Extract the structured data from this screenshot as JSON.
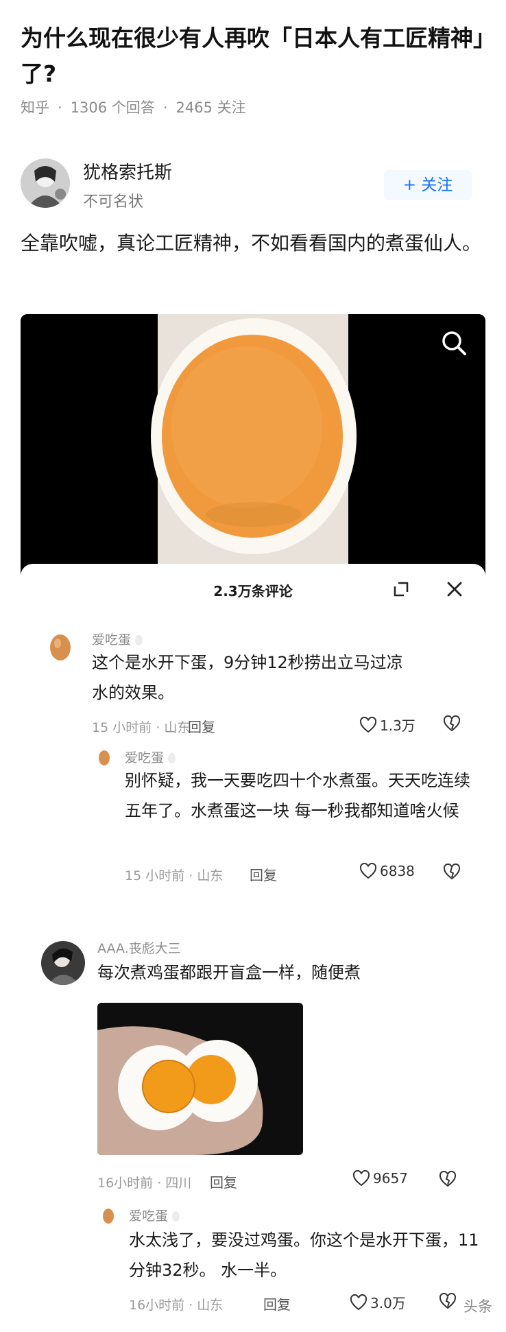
{
  "question": {
    "title": "为什么现在很少有人再吹「日本人有工匠精神」了?",
    "source": "知乎",
    "answers_count": "1306 个回答",
    "follows_count": "2465 关注"
  },
  "author": {
    "name": "犹格索托斯",
    "bio": "不可名状",
    "follow_label": "+ 关注"
  },
  "answer": {
    "text": "全靠吹嘘，真论工匠精神，不如看看国内的煮蛋仙人。"
  },
  "comments_panel": {
    "title": "2.3万条评论"
  },
  "comments": [
    {
      "username": "爱吃蛋",
      "text": "这个是水开下蛋，9分钟12秒捞出立马过凉水的效果。",
      "time_location": "15 小时前 · 山东",
      "reply_label": "回复",
      "likes": "1.3万"
    },
    {
      "username": "爱吃蛋",
      "text": "别怀疑，我一天要吃四十个水煮蛋。天天吃连续五年了。水煮蛋这一块 每一秒我都知道啥火候",
      "time_location": "15 小时前 · 山东",
      "reply_label": "回复",
      "likes": "6838"
    },
    {
      "username": "AAA.丧彪大三",
      "text": "每次煮鸡蛋都跟开盲盒一样，随便煮",
      "time_location": "16小时前 · 四川",
      "reply_label": "回复",
      "likes": "9657"
    },
    {
      "username": "爱吃蛋",
      "text": "水太浅了，要没过鸡蛋。你这个是水开下蛋，11分钟32秒。 水一半。",
      "time_location": "16小时前 · 山东",
      "reply_label": "回复",
      "likes": "3.0万"
    }
  ],
  "watermark": "头条"
}
